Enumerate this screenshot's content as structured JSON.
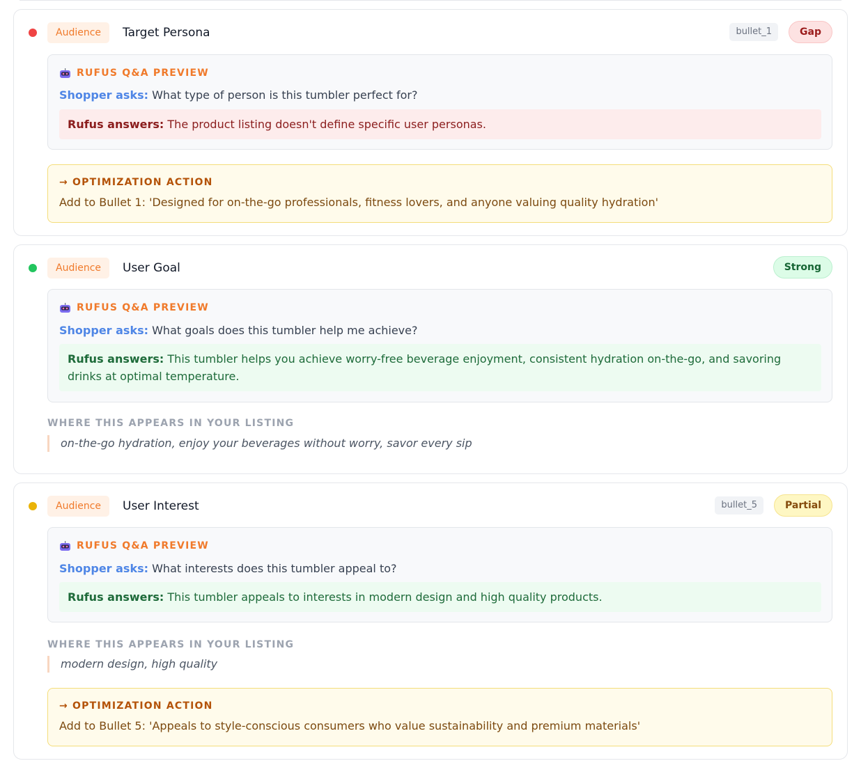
{
  "colors": {
    "gap_dot": "#ef4444",
    "strong_dot": "#22c55e",
    "partial_dot": "#eab308",
    "category_text": "#f07a2b",
    "shopper_label": "#4f86e6"
  },
  "cards": [
    {
      "category": "Audience",
      "title": "Target Persona",
      "ref": "bullet_1",
      "status": "Gap",
      "preview": {
        "icon": "robot-icon",
        "label": "RUFUS Q&A PREVIEW",
        "shopper_label": "Shopper asks:",
        "question": "What type of person is this tumbler perfect for?",
        "rufus_label": "Rufus answers:",
        "answer": "The product listing doesn't define specific user personas."
      },
      "action": {
        "label": "→ OPTIMIZATION ACTION",
        "text": "Add to Bullet 1: 'Designed for on-the-go professionals, fitness lovers, and anyone valuing quality hydration'"
      }
    },
    {
      "category": "Audience",
      "title": "User Goal",
      "status": "Strong",
      "preview": {
        "icon": "robot-icon",
        "label": "RUFUS Q&A PREVIEW",
        "shopper_label": "Shopper asks:",
        "question": "What goals does this tumbler help me achieve?",
        "rufus_label": "Rufus answers:",
        "answer": "This tumbler helps you achieve worry-free beverage enjoyment, consistent hydration on-the-go, and savoring drinks at optimal temperature."
      },
      "appears": {
        "label": "WHERE THIS APPEARS IN YOUR LISTING",
        "quote": "on-the-go hydration, enjoy your beverages without worry, savor every sip"
      }
    },
    {
      "category": "Audience",
      "title": "User Interest",
      "ref": "bullet_5",
      "status": "Partial",
      "preview": {
        "icon": "robot-icon",
        "label": "RUFUS Q&A PREVIEW",
        "shopper_label": "Shopper asks:",
        "question": "What interests does this tumbler appeal to?",
        "rufus_label": "Rufus answers:",
        "answer": "This tumbler appeals to interests in modern design and high quality products."
      },
      "appears": {
        "label": "WHERE THIS APPEARS IN YOUR LISTING",
        "quote": "modern design, high quality"
      },
      "action": {
        "label": "→ OPTIMIZATION ACTION",
        "text": "Add to Bullet 5: 'Appeals to style-conscious consumers who value sustainability and premium materials'"
      }
    }
  ]
}
